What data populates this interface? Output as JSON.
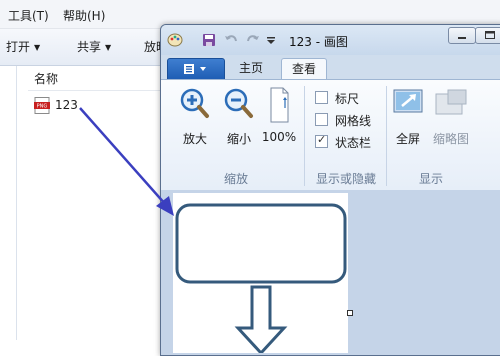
{
  "explorer": {
    "menu": [
      "工具(T)",
      "帮助(H)"
    ],
    "toolbar": [
      "打开",
      "共享",
      "放映"
    ],
    "column_header": "名称",
    "file": {
      "name": "123",
      "icon": "png-file-icon"
    }
  },
  "paint": {
    "title": "123 - 画图",
    "file_menu_icon": "paint-menu-icon",
    "tabs": [
      {
        "label": "主页",
        "active": false
      },
      {
        "label": "查看",
        "active": true
      }
    ],
    "zoom_group": {
      "label": "缩放",
      "zoom_in": "放大",
      "zoom_out": "缩小",
      "percent_100": "100%"
    },
    "show_hide_group": {
      "label": "显示或隐藏",
      "checkboxes": [
        {
          "label": "标尺",
          "checked": false
        },
        {
          "label": "网格线",
          "checked": false
        },
        {
          "label": "状态栏",
          "checked": true
        }
      ]
    },
    "display_group": {
      "label": "显示",
      "fullscreen": "全屏",
      "thumbnail": "缩略图"
    }
  },
  "colors": {
    "accent_blue": "#1f5eb4",
    "arrow": "#3b3fbf",
    "shape_stroke": "#355a7c"
  }
}
